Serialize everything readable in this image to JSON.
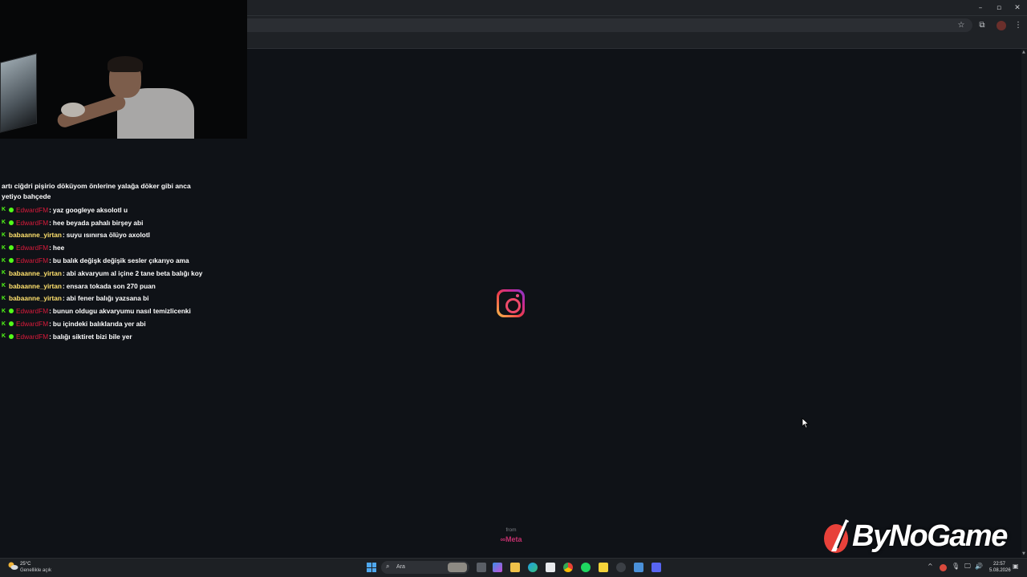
{
  "window_controls": {
    "minimize": "–",
    "maximize": "▫",
    "close": "✕"
  },
  "toolbar": {
    "star_glyph": "☆",
    "extensions_glyph": "⧉",
    "menu_glyph": "⋮"
  },
  "chat": {
    "first_message": "artı ciğdri pişirio döküyom önlerine yalağa döker gibi anca yetiyo bahçede",
    "messages": [
      {
        "user": "EdwardFM",
        "user_color": "red",
        "badges": [
          "kick",
          "green"
        ],
        "text": "yaz googleye aksolotl u"
      },
      {
        "user": "EdwardFM",
        "user_color": "red",
        "badges": [
          "kick",
          "green"
        ],
        "text": "hee beyada pahalı birşey abi"
      },
      {
        "user": "babaanne_yirtan",
        "user_color": "yellow",
        "badges": [
          "kick"
        ],
        "text": "suyu ısınırsa ölüyo axolotl"
      },
      {
        "user": "EdwardFM",
        "user_color": "red",
        "badges": [
          "kick",
          "green"
        ],
        "text": "hee"
      },
      {
        "user": "EdwardFM",
        "user_color": "red",
        "badges": [
          "kick",
          "green"
        ],
        "text": "bu balık değişk değişik sesler çıkarıyo ama"
      },
      {
        "user": "babaanne_yirtan",
        "user_color": "yellow",
        "badges": [
          "kick"
        ],
        "text": "abi akvaryum al içine 2 tane beta balığı koy"
      },
      {
        "user": "babaanne_yirtan",
        "user_color": "yellow",
        "badges": [
          "kick"
        ],
        "text": "ensara tokada son 270 puan"
      },
      {
        "user": "babaanne_yirtan",
        "user_color": "yellow",
        "badges": [
          "kick"
        ],
        "text": "abi fener balığı yazsana bi"
      },
      {
        "user": "EdwardFM",
        "user_color": "red",
        "badges": [
          "kick",
          "green"
        ],
        "text": "bunun oldugu akvaryumu nasıl temizlicenki"
      },
      {
        "user": "EdwardFM",
        "user_color": "red",
        "badges": [
          "kick",
          "green"
        ],
        "text": "bu içindeki balıklarıda yer abi"
      },
      {
        "user": "EdwardFM",
        "user_color": "red",
        "badges": [
          "kick",
          "green"
        ],
        "text": "balığı siktiret bizi bile yer"
      }
    ]
  },
  "splash": {
    "from_label": "from",
    "meta_label": "∞Meta",
    "logo_icon": "instagram-icon"
  },
  "watermark": {
    "text": "ByNoGame"
  },
  "taskbar": {
    "weather_temp": "25°C",
    "weather_desc": "Genellikle açık",
    "search_placeholder": "Ara",
    "time": "22:57",
    "date": "5.08.2026",
    "tray_chevron": "^"
  },
  "colors": {
    "chat_red": "#d81b3b",
    "chat_yellow": "#ffe16d",
    "kick_green": "#53fc18",
    "page_bg": "#0f1217"
  }
}
